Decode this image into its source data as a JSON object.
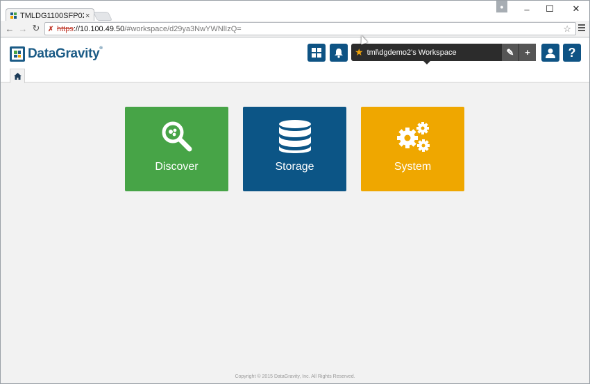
{
  "browser": {
    "tab_title": "TMLDG1100SFP02 -",
    "tab_close": "×",
    "url_scheme": "https",
    "url_host": "://10.100.49.50",
    "url_path": "/#workspace/d29ya3NwYWNlIzQ=",
    "window_controls": [
      "–",
      "☐",
      "✕"
    ]
  },
  "app": {
    "logo_text": "DataGravity",
    "logo_mark": "®",
    "workspace_name": "tml\\dgdemo2's Workspace",
    "edit_icon": "✎",
    "add_icon": "+",
    "help_icon": "?"
  },
  "tiles": [
    {
      "label": "Discover",
      "color": "#47a447",
      "icon": "magnifier-icon"
    },
    {
      "label": "Storage",
      "color": "#0c5586",
      "icon": "database-icon"
    },
    {
      "label": "System",
      "color": "#efa700",
      "icon": "gears-icon"
    }
  ],
  "footer": {
    "text": "Copyright © 2015 DataGravity, Inc. All Rights Reserved."
  }
}
